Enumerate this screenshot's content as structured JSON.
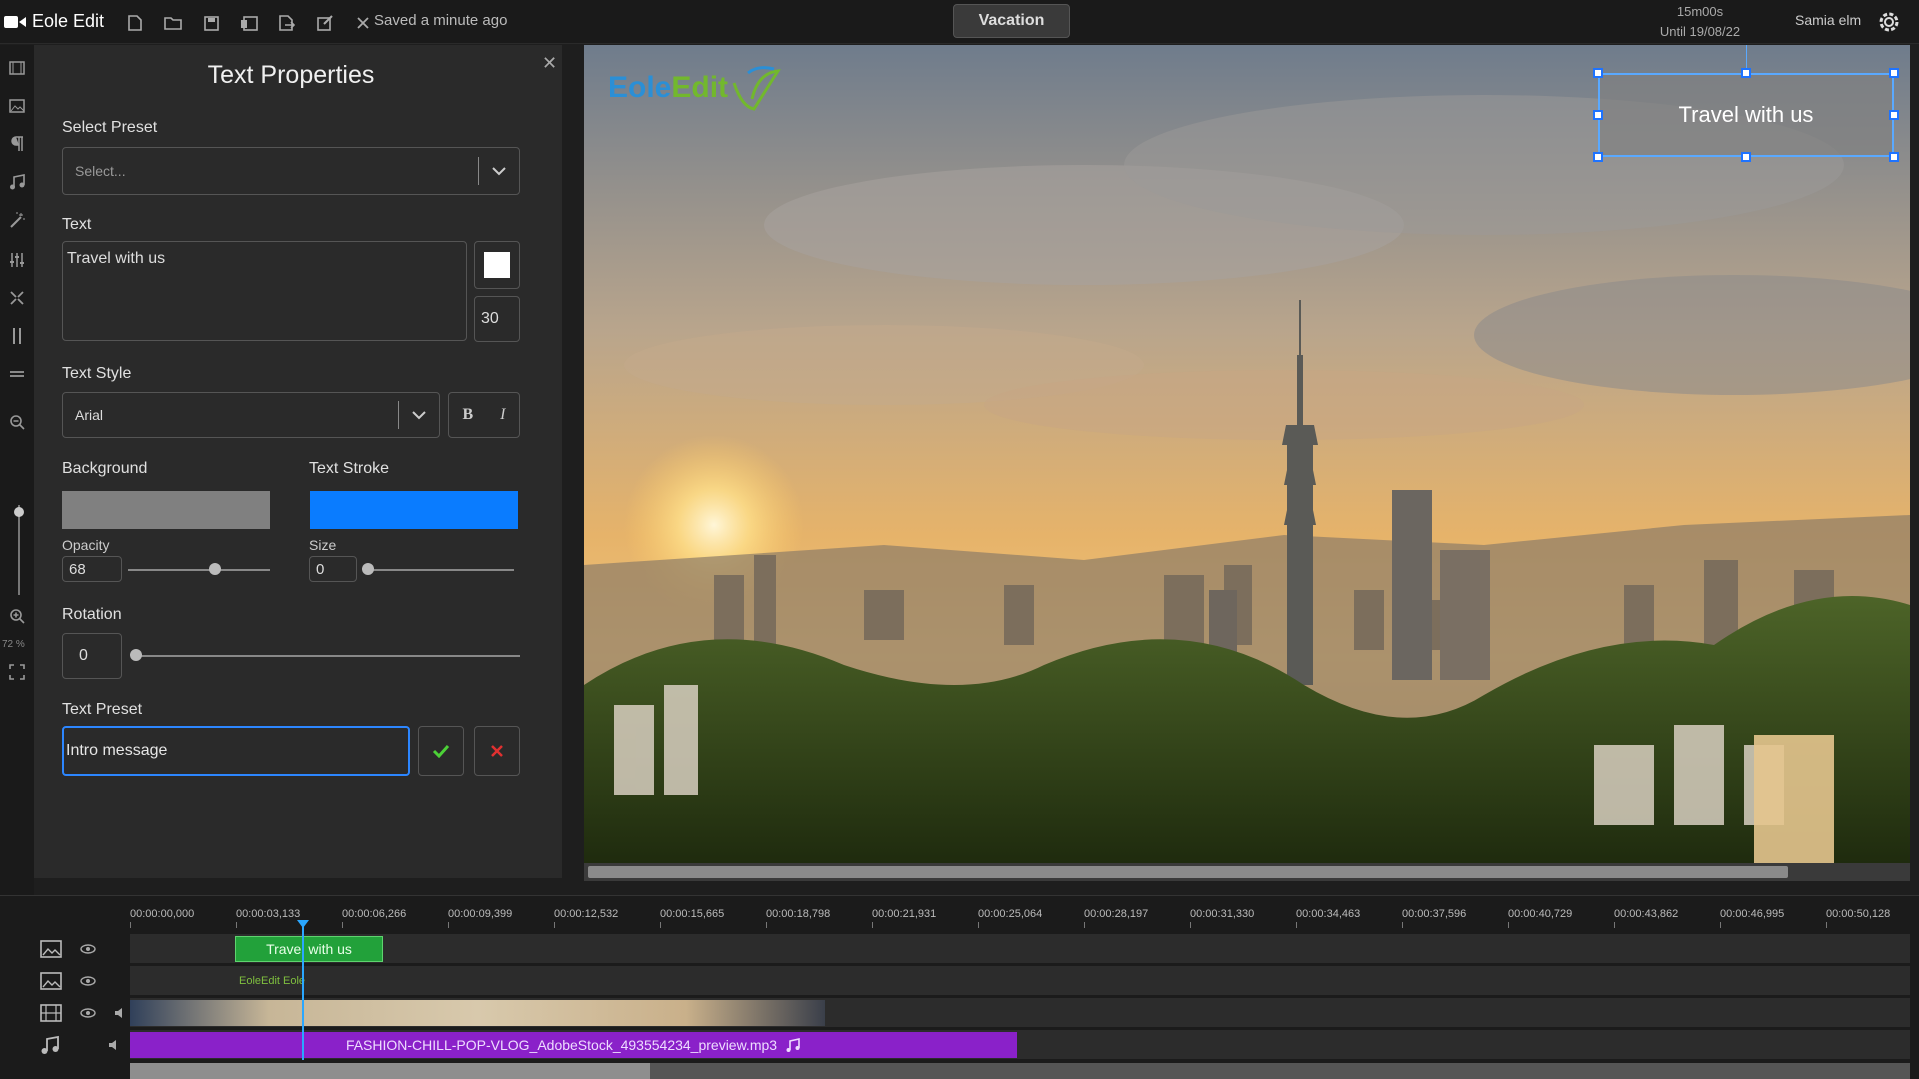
{
  "app": {
    "name": "Eole Edit",
    "saved_status": "Saved a minute ago",
    "project_name": "Vacation",
    "quota_time": "15m00s",
    "quota_until": "Until 19/08/22",
    "user_name": "Samia elm"
  },
  "toolbar": {
    "icons": [
      "new-file-icon",
      "open-folder-icon",
      "save-icon",
      "save-as-icon",
      "export-icon",
      "edit-icon",
      "close-icon"
    ]
  },
  "left_rail": {
    "zoom_percent": "72 %",
    "icons": [
      "media-icon",
      "image-icon",
      "text-icon",
      "music-icon",
      "magic-wand-icon",
      "equalizer-icon",
      "transition-icon",
      "split-icon",
      "align-icon",
      "zoom-out-icon",
      "zoom-in-icon",
      "fullscreen-icon"
    ]
  },
  "panel": {
    "title": "Text Properties",
    "select_preset_label": "Select Preset",
    "select_preset_placeholder": "Select...",
    "text_label": "Text",
    "text_value": "Travel with us",
    "font_size": "30",
    "text_style_label": "Text Style",
    "font_name": "Arial",
    "bold_label": "B",
    "italic_label": "I",
    "background_label": "Background",
    "background_color": "#808080",
    "stroke_label": "Text Stroke",
    "stroke_color": "#0a7cff",
    "opacity_label": "Opacity",
    "opacity_value": "68",
    "size_label": "Size",
    "size_value": "0",
    "rotation_label": "Rotation",
    "rotation_value": "0",
    "text_preset_label": "Text Preset",
    "text_preset_value": "Intro message",
    "confirm_icon": "check-icon",
    "cancel_icon": "x-icon"
  },
  "preview": {
    "logo_part1": "Eole",
    "logo_part2": "Edit",
    "overlay_text": "Travel with us"
  },
  "timeline": {
    "ruler": [
      "00:00:00,000",
      "00:00:03,133",
      "00:00:06,266",
      "00:00:09,399",
      "00:00:12,532",
      "00:00:15,665",
      "00:00:18,798",
      "00:00:21,931",
      "00:00:25,064",
      "00:00:28,197",
      "00:00:31,330",
      "00:00:34,463",
      "00:00:37,596",
      "00:00:40,729",
      "00:00:43,862",
      "00:00:46,995",
      "00:00:50,128"
    ],
    "tracks": [
      {
        "type": "text",
        "clip_label": "Travel with us"
      },
      {
        "type": "image",
        "clip_label": "EoleEdit  Eole"
      },
      {
        "type": "video",
        "clip_label": ""
      },
      {
        "type": "audio",
        "clip_label": "FASHION-CHILL-POP-VLOG_AdobeStock_493554234_preview.mp3"
      }
    ]
  }
}
